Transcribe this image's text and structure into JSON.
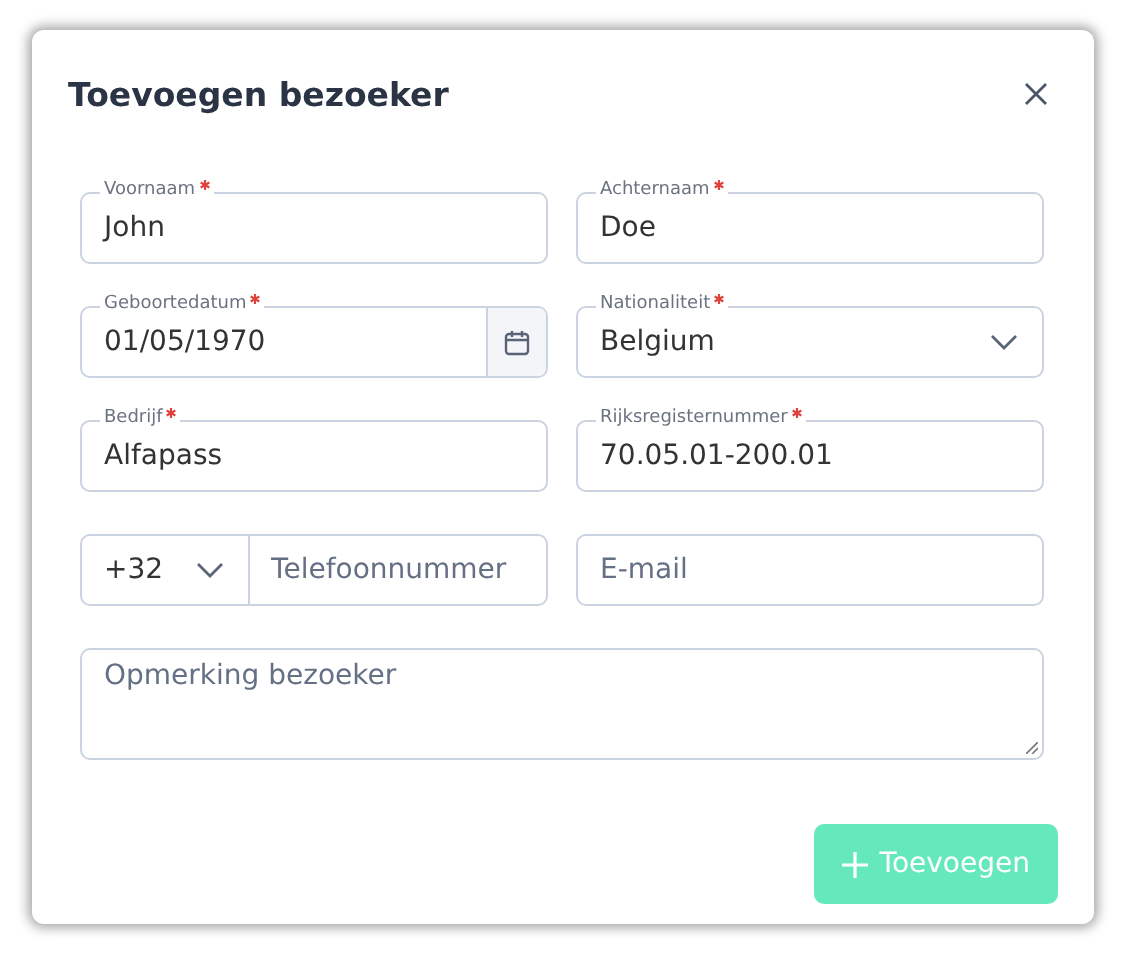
{
  "dialog": {
    "title": "Toevoegen bezoeker"
  },
  "fields": [
    {
      "kind": "text",
      "label": "Voornaam",
      "required": true,
      "value": "John"
    },
    {
      "kind": "text",
      "label": "Achternaam",
      "required": true,
      "value": "Doe"
    },
    {
      "kind": "date",
      "label": "Geboortedatum",
      "required": true,
      "value": "01/05/1970"
    },
    {
      "kind": "select",
      "label": "Nationaliteit",
      "required": true,
      "value": "Belgium"
    },
    {
      "kind": "text",
      "label": "Bedrijf",
      "required": true,
      "value": "Alfapass"
    },
    {
      "kind": "text",
      "label": "Rijksregisternummer",
      "required": true,
      "value": "70.05.01-200.01"
    },
    {
      "kind": "phone",
      "country_code": "+32",
      "placeholder": "Telefoonnummer"
    },
    {
      "kind": "text",
      "placeholder": "E-mail"
    },
    {
      "kind": "textarea",
      "placeholder": "Opmerking bezoeker"
    }
  ],
  "submit": {
    "label": "Toevoegen",
    "disabled": true
  }
}
